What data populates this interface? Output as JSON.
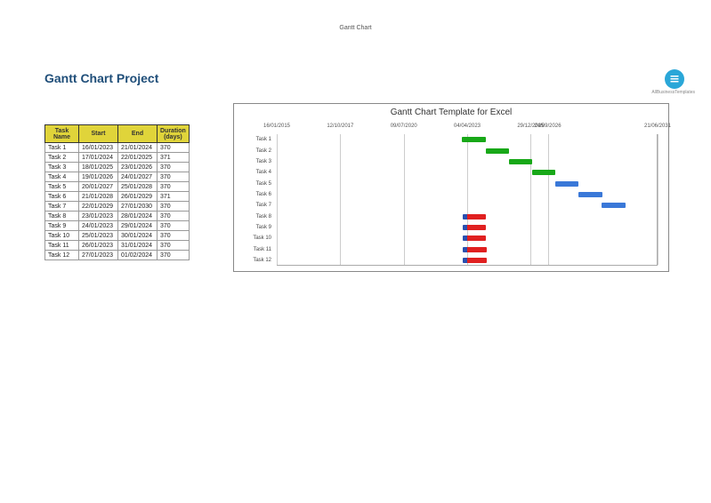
{
  "doc_title": "Gantt Chart",
  "page_title": "Gantt Chart Project",
  "logo_caption": "AllBusinessTemplates",
  "table": {
    "headers": [
      "Task Name",
      "Start",
      "End",
      "Duration (days)"
    ],
    "rows": [
      [
        "Task 1",
        "16/01/2023",
        "21/01/2024",
        "370"
      ],
      [
        "Task 2",
        "17/01/2024",
        "22/01/2025",
        "371"
      ],
      [
        "Task 3",
        "18/01/2025",
        "23/01/2026",
        "370"
      ],
      [
        "Task 4",
        "19/01/2026",
        "24/01/2027",
        "370"
      ],
      [
        "Task 5",
        "20/01/2027",
        "25/01/2028",
        "370"
      ],
      [
        "Task 6",
        "21/01/2028",
        "26/01/2029",
        "371"
      ],
      [
        "Task 7",
        "22/01/2029",
        "27/01/2030",
        "370"
      ],
      [
        "Task 8",
        "23/01/2023",
        "28/01/2024",
        "370"
      ],
      [
        "Task 9",
        "24/01/2023",
        "29/01/2024",
        "370"
      ],
      [
        "Task 10",
        "25/01/2023",
        "30/01/2024",
        "370"
      ],
      [
        "Task 11",
        "26/01/2023",
        "31/01/2024",
        "370"
      ],
      [
        "Task 12",
        "27/01/2023",
        "01/02/2024",
        "370"
      ]
    ]
  },
  "chart_data": {
    "type": "gantt",
    "title": "Gantt Chart Template for Excel",
    "x_ticks": [
      "16/01/2015",
      "12/10/2017",
      "09/07/2020",
      "04/04/2023",
      "29/12/2025",
      "24/09/2026",
      "21/06/2031"
    ],
    "x_range_days": [
      42020,
      48020
    ],
    "y_labels": [
      "Task 1",
      "Task 2",
      "Task 3",
      "Task 4",
      "Task 5",
      "Task 6",
      "Task 7",
      "Task 8",
      "Task 9",
      "Task 10",
      "Task 11",
      "Task 12"
    ],
    "bars": [
      {
        "task": "Task 1",
        "start": "16/01/2023",
        "end": "21/01/2024",
        "color": "green"
      },
      {
        "task": "Task 2",
        "start": "17/01/2024",
        "end": "22/01/2025",
        "color": "green"
      },
      {
        "task": "Task 3",
        "start": "18/01/2025",
        "end": "23/01/2026",
        "color": "green"
      },
      {
        "task": "Task 4",
        "start": "19/01/2026",
        "end": "24/01/2027",
        "color": "green"
      },
      {
        "task": "Task 5",
        "start": "20/01/2027",
        "end": "25/01/2028",
        "color": "blue"
      },
      {
        "task": "Task 6",
        "start": "21/01/2028",
        "end": "26/01/2029",
        "color": "blue"
      },
      {
        "task": "Task 7",
        "start": "22/01/2029",
        "end": "27/01/2030",
        "color": "blue"
      },
      {
        "task": "Task 8",
        "start": "23/01/2023",
        "end": "28/01/2024",
        "color": "red"
      },
      {
        "task": "Task 9",
        "start": "24/01/2023",
        "end": "29/01/2024",
        "color": "red"
      },
      {
        "task": "Task 10",
        "start": "25/01/2023",
        "end": "30/01/2024",
        "color": "red"
      },
      {
        "task": "Task 11",
        "start": "26/01/2023",
        "end": "31/01/2024",
        "color": "red"
      },
      {
        "task": "Task 12",
        "start": "27/01/2023",
        "end": "01/02/2024",
        "color": "red"
      }
    ]
  }
}
